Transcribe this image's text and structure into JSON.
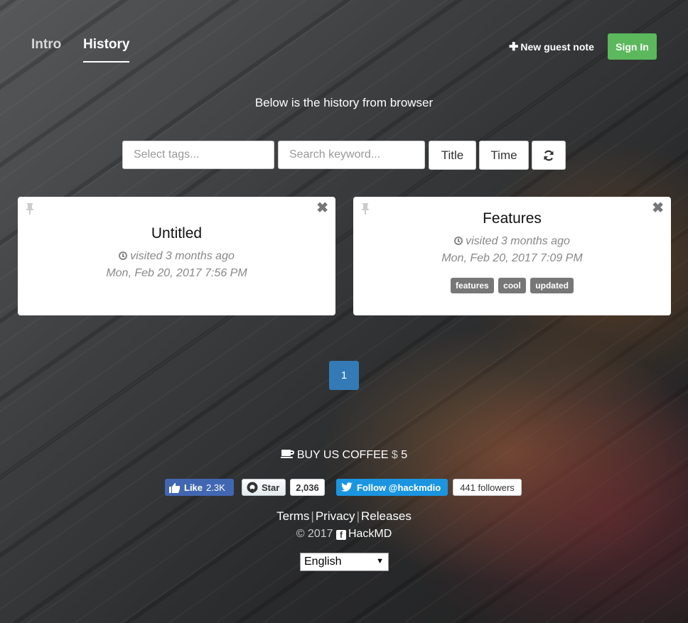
{
  "nav": {
    "tabs": [
      {
        "label": "Intro",
        "active": false
      },
      {
        "label": "History",
        "active": true
      }
    ],
    "new_guest_note_label": "New guest note",
    "sign_in_label": "Sign In"
  },
  "history": {
    "subtitle": "Below is the history from browser",
    "filters": {
      "tags_placeholder": "Select tags...",
      "keyword_placeholder": "Search keyword...",
      "sort_title_label": "Title",
      "sort_time_label": "Time"
    },
    "notes": [
      {
        "title": "Untitled",
        "visited": "visited 3 months ago",
        "date": "Mon, Feb 20, 2017 7:56 PM",
        "tags": []
      },
      {
        "title": "Features",
        "visited": "visited 3 months ago",
        "date": "Mon, Feb 20, 2017 7:09 PM",
        "tags": [
          "features",
          "cool",
          "updated"
        ]
      }
    ],
    "pagination": {
      "current_page": "1"
    }
  },
  "footer": {
    "coffee_label": "BUY US COFFEE",
    "coffee_currency": "$",
    "coffee_amount": "5",
    "social": {
      "fb_like_label": "Like",
      "fb_like_count": "2.3K",
      "gh_star_label": "Star",
      "gh_star_count": "2,036",
      "tw_follow_label": "Follow @hackmdio",
      "tw_followers": "441 followers"
    },
    "links": [
      "Terms",
      "Privacy",
      "Releases"
    ],
    "copyright_year": "© 2017",
    "brand": "HackMD",
    "language": "English"
  },
  "colors": {
    "sign_in_green": "#5cb85c",
    "pagination_blue": "#337ab7",
    "facebook_blue": "#4267b2",
    "twitter_blue": "#1b95e0",
    "tag_gray": "#777777"
  },
  "icons": [
    "plus-icon",
    "clock-icon",
    "pin-icon",
    "close-icon",
    "refresh-icon",
    "coffee-icon",
    "thumbs-up-icon",
    "github-icon",
    "twitter-icon",
    "facebook-square-icon"
  ]
}
